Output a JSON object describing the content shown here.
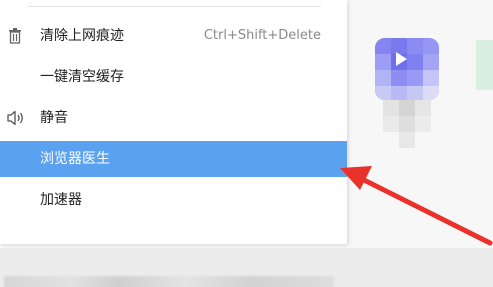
{
  "menu": {
    "items": [
      {
        "label": "清除上网痕迹",
        "shortcut": "Ctrl+Shift+Delete",
        "icon": "trash-icon"
      },
      {
        "label": "一键清空缓存",
        "shortcut": "",
        "icon": ""
      },
      {
        "label": "静音",
        "shortcut": "",
        "icon": "speaker-icon"
      },
      {
        "label": "浏览器医生",
        "shortcut": "",
        "icon": ""
      },
      {
        "label": "加速器",
        "shortcut": "",
        "icon": ""
      }
    ],
    "highlighted_index": 3,
    "highlight_color": "#5aa2ef"
  },
  "annotation": {
    "arrow_color": "#e8322b"
  },
  "colors": {
    "app_tile": "#7f7ff0",
    "green_tile": "#d9efdf"
  }
}
